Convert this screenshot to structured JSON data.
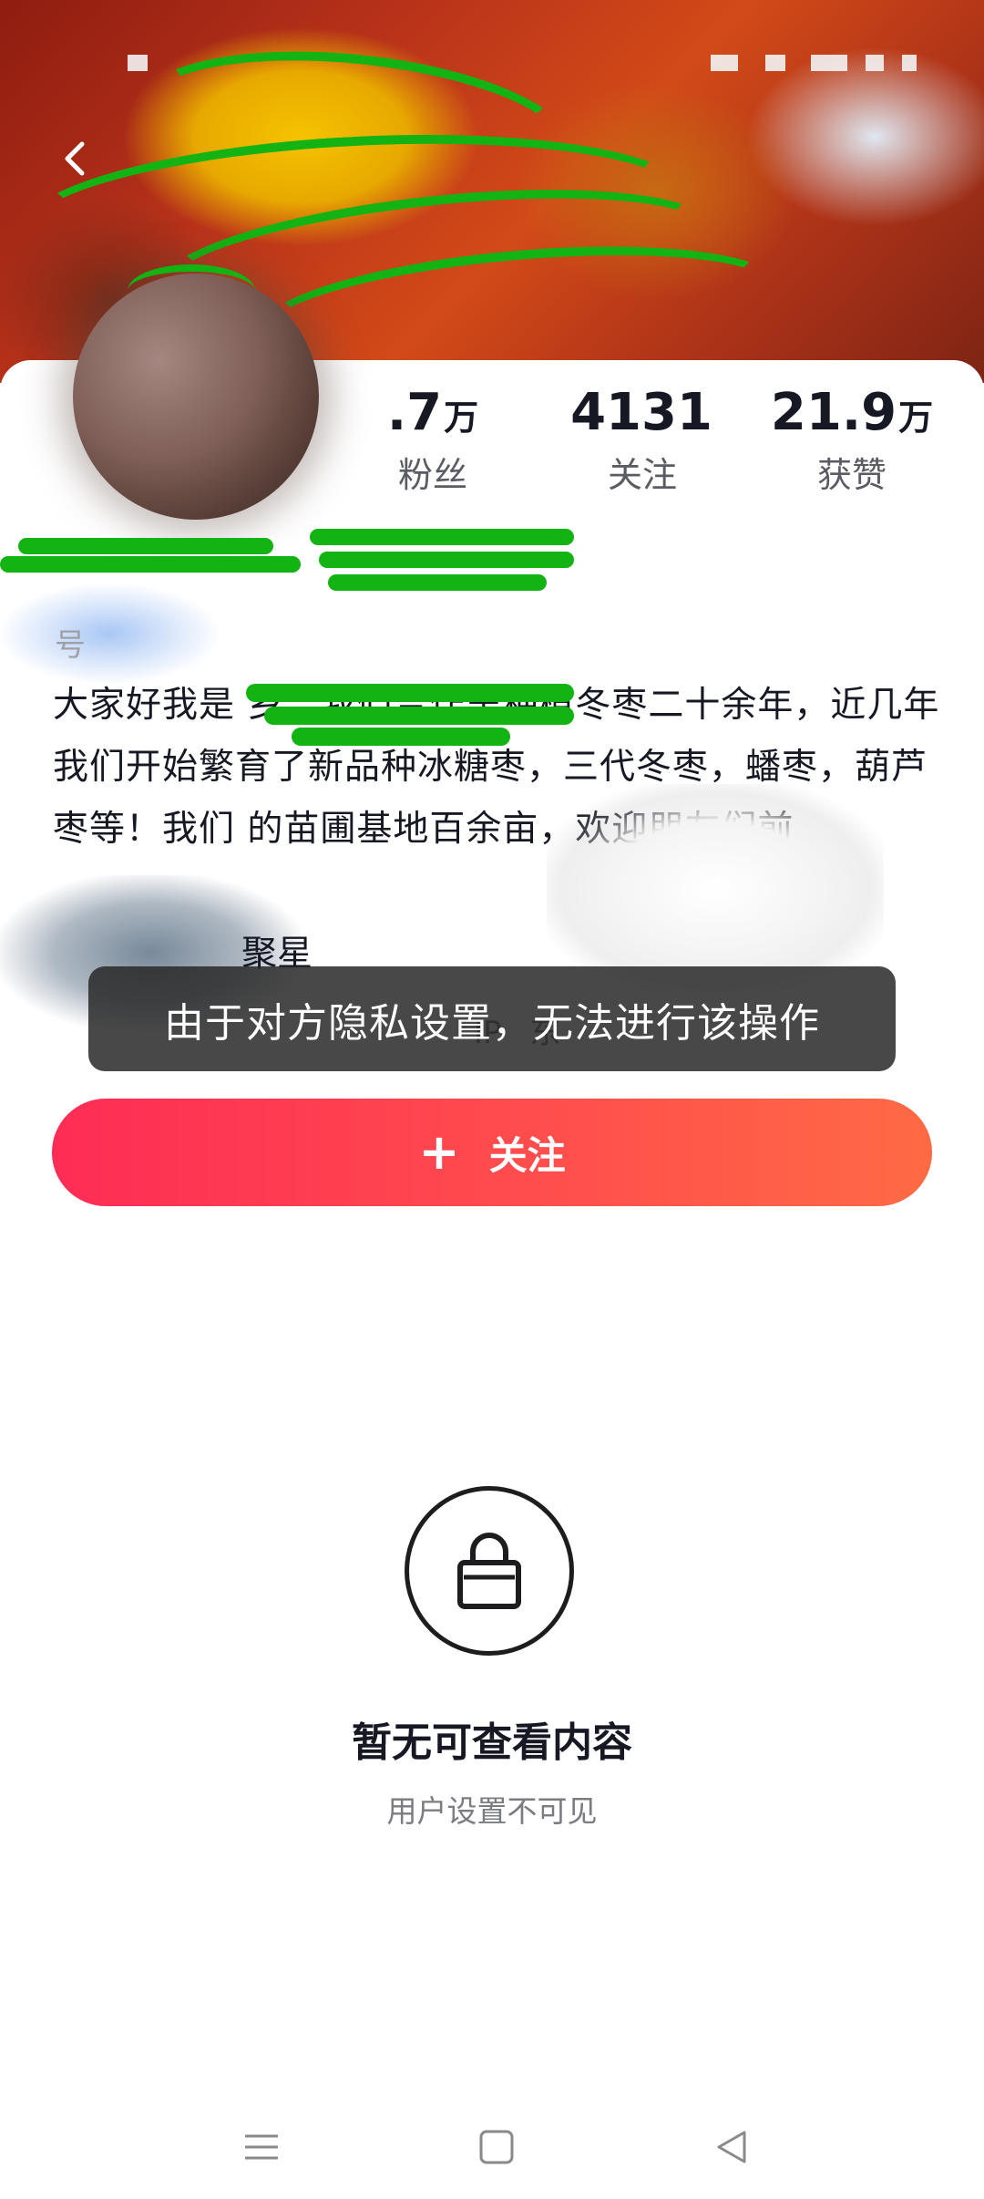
{
  "stats": [
    {
      "key": "fans",
      "value": ".7",
      "unit": "万",
      "label": "粉丝"
    },
    {
      "key": "following",
      "value": "4131",
      "unit": "",
      "label": "关注"
    },
    {
      "key": "likes",
      "value": "21.9",
      "unit": "万",
      "label": "获赞"
    }
  ],
  "profile": {
    "account_id_suffix": "号",
    "bio": "大家好我是 乡。我们合作舍种植冬枣二十余年，近几年我们开始繁育了新品种冰糖枣，三代冬枣，蟠枣，葫芦枣等！我们 的苗圃基地百余亩，欢迎朋友们前",
    "tag": "聚星",
    "meta": "IP",
    "meta_tail": "东"
  },
  "toast": {
    "text": "由于对方隐私设置，无法进行该操作"
  },
  "follow_button": {
    "plus": "+",
    "label": "关注"
  },
  "private_state": {
    "title": "暂无可查看内容",
    "subtitle": "用户设置不可见"
  },
  "colors": {
    "accent_start": "#fe2c55",
    "accent_end": "#ff6a44",
    "toast_bg": "#282828",
    "censor_green": "#12b312"
  },
  "icons": {
    "back": "back-arrow-icon",
    "lock": "lock-icon",
    "nav_menu": "menu-icon",
    "nav_home": "home-square-icon",
    "nav_back": "back-triangle-icon"
  }
}
